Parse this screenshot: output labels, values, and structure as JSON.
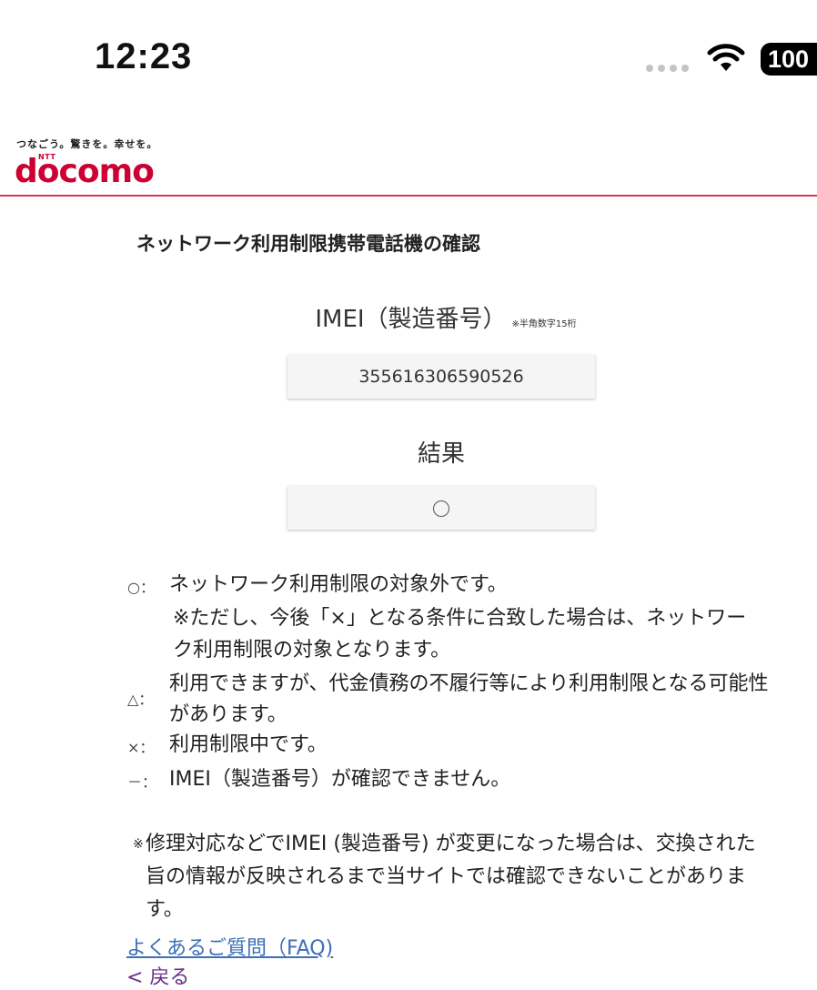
{
  "status_bar": {
    "time": "12:23",
    "battery": "100",
    "wifi_icon": "wifi-icon",
    "signal_icon": "signal-dots-icon"
  },
  "header": {
    "tagline": "つなごう。驚きを。幸せを。",
    "logo_ntt": "NTT",
    "logo_text": "docomo",
    "brand_color": "#cc0033"
  },
  "page": {
    "title": "ネットワーク利用制限携帯電話機の確認",
    "imei_label": "IMEI（製造番号）",
    "imei_note": "※半角数字15桁",
    "imei_value": "355616306590526",
    "result_label": "結果",
    "result_value": "○"
  },
  "legend": [
    {
      "symbol": "○：",
      "text": "ネットワーク利用制限の対象外です。",
      "sub": "※ただし、今後「×」となる条件に合致した場合は、ネットワーク利用制限の対象となります。"
    },
    {
      "symbol": "△：",
      "text": "利用できますが、代金債務の不履行等により利用制限となる可能性があります。"
    },
    {
      "symbol": "×：",
      "text": "利用制限中です。"
    },
    {
      "symbol": "－：",
      "text": "IMEI（製造番号）が確認できません。"
    }
  ],
  "notice": {
    "mark": "※",
    "text": "修理対応などでIMEI (製造番号) が変更になった場合は、交換された旨の情報が反映されるまで当サイトでは確認できないことがあります。"
  },
  "links": {
    "faq": "よくあるご質問（FAQ)",
    "back": "< 戻る"
  }
}
